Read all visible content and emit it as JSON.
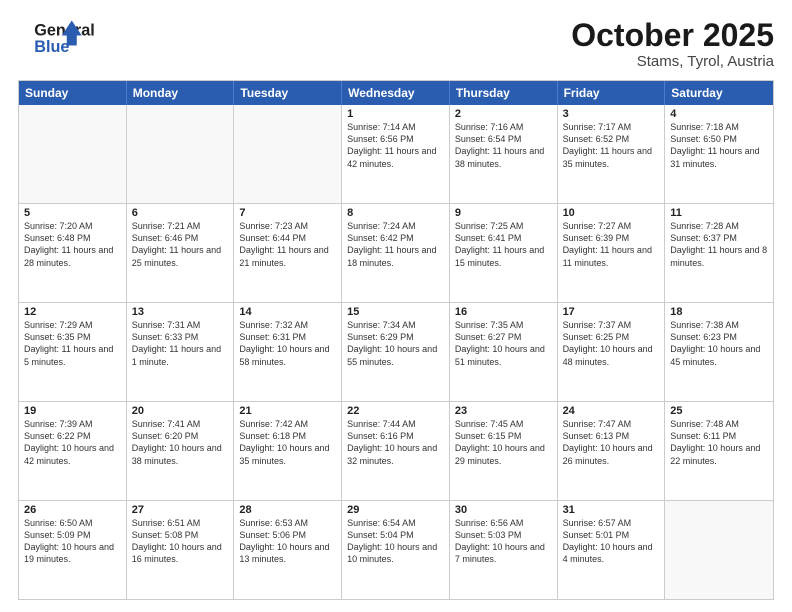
{
  "header": {
    "logo_general": "General",
    "logo_blue": "Blue",
    "month": "October 2025",
    "location": "Stams, Tyrol, Austria"
  },
  "weekdays": [
    "Sunday",
    "Monday",
    "Tuesday",
    "Wednesday",
    "Thursday",
    "Friday",
    "Saturday"
  ],
  "weeks": [
    [
      {
        "day": "",
        "text": "",
        "empty": true
      },
      {
        "day": "",
        "text": "",
        "empty": true
      },
      {
        "day": "",
        "text": "",
        "empty": true
      },
      {
        "day": "1",
        "text": "Sunrise: 7:14 AM\nSunset: 6:56 PM\nDaylight: 11 hours and 42 minutes."
      },
      {
        "day": "2",
        "text": "Sunrise: 7:16 AM\nSunset: 6:54 PM\nDaylight: 11 hours and 38 minutes."
      },
      {
        "day": "3",
        "text": "Sunrise: 7:17 AM\nSunset: 6:52 PM\nDaylight: 11 hours and 35 minutes."
      },
      {
        "day": "4",
        "text": "Sunrise: 7:18 AM\nSunset: 6:50 PM\nDaylight: 11 hours and 31 minutes."
      }
    ],
    [
      {
        "day": "5",
        "text": "Sunrise: 7:20 AM\nSunset: 6:48 PM\nDaylight: 11 hours and 28 minutes."
      },
      {
        "day": "6",
        "text": "Sunrise: 7:21 AM\nSunset: 6:46 PM\nDaylight: 11 hours and 25 minutes."
      },
      {
        "day": "7",
        "text": "Sunrise: 7:23 AM\nSunset: 6:44 PM\nDaylight: 11 hours and 21 minutes."
      },
      {
        "day": "8",
        "text": "Sunrise: 7:24 AM\nSunset: 6:42 PM\nDaylight: 11 hours and 18 minutes."
      },
      {
        "day": "9",
        "text": "Sunrise: 7:25 AM\nSunset: 6:41 PM\nDaylight: 11 hours and 15 minutes."
      },
      {
        "day": "10",
        "text": "Sunrise: 7:27 AM\nSunset: 6:39 PM\nDaylight: 11 hours and 11 minutes."
      },
      {
        "day": "11",
        "text": "Sunrise: 7:28 AM\nSunset: 6:37 PM\nDaylight: 11 hours and 8 minutes."
      }
    ],
    [
      {
        "day": "12",
        "text": "Sunrise: 7:29 AM\nSunset: 6:35 PM\nDaylight: 11 hours and 5 minutes."
      },
      {
        "day": "13",
        "text": "Sunrise: 7:31 AM\nSunset: 6:33 PM\nDaylight: 11 hours and 1 minute."
      },
      {
        "day": "14",
        "text": "Sunrise: 7:32 AM\nSunset: 6:31 PM\nDaylight: 10 hours and 58 minutes."
      },
      {
        "day": "15",
        "text": "Sunrise: 7:34 AM\nSunset: 6:29 PM\nDaylight: 10 hours and 55 minutes."
      },
      {
        "day": "16",
        "text": "Sunrise: 7:35 AM\nSunset: 6:27 PM\nDaylight: 10 hours and 51 minutes."
      },
      {
        "day": "17",
        "text": "Sunrise: 7:37 AM\nSunset: 6:25 PM\nDaylight: 10 hours and 48 minutes."
      },
      {
        "day": "18",
        "text": "Sunrise: 7:38 AM\nSunset: 6:23 PM\nDaylight: 10 hours and 45 minutes."
      }
    ],
    [
      {
        "day": "19",
        "text": "Sunrise: 7:39 AM\nSunset: 6:22 PM\nDaylight: 10 hours and 42 minutes."
      },
      {
        "day": "20",
        "text": "Sunrise: 7:41 AM\nSunset: 6:20 PM\nDaylight: 10 hours and 38 minutes."
      },
      {
        "day": "21",
        "text": "Sunrise: 7:42 AM\nSunset: 6:18 PM\nDaylight: 10 hours and 35 minutes."
      },
      {
        "day": "22",
        "text": "Sunrise: 7:44 AM\nSunset: 6:16 PM\nDaylight: 10 hours and 32 minutes."
      },
      {
        "day": "23",
        "text": "Sunrise: 7:45 AM\nSunset: 6:15 PM\nDaylight: 10 hours and 29 minutes."
      },
      {
        "day": "24",
        "text": "Sunrise: 7:47 AM\nSunset: 6:13 PM\nDaylight: 10 hours and 26 minutes."
      },
      {
        "day": "25",
        "text": "Sunrise: 7:48 AM\nSunset: 6:11 PM\nDaylight: 10 hours and 22 minutes."
      }
    ],
    [
      {
        "day": "26",
        "text": "Sunrise: 6:50 AM\nSunset: 5:09 PM\nDaylight: 10 hours and 19 minutes."
      },
      {
        "day": "27",
        "text": "Sunrise: 6:51 AM\nSunset: 5:08 PM\nDaylight: 10 hours and 16 minutes."
      },
      {
        "day": "28",
        "text": "Sunrise: 6:53 AM\nSunset: 5:06 PM\nDaylight: 10 hours and 13 minutes."
      },
      {
        "day": "29",
        "text": "Sunrise: 6:54 AM\nSunset: 5:04 PM\nDaylight: 10 hours and 10 minutes."
      },
      {
        "day": "30",
        "text": "Sunrise: 6:56 AM\nSunset: 5:03 PM\nDaylight: 10 hours and 7 minutes."
      },
      {
        "day": "31",
        "text": "Sunrise: 6:57 AM\nSunset: 5:01 PM\nDaylight: 10 hours and 4 minutes."
      },
      {
        "day": "",
        "text": "",
        "empty": true
      }
    ]
  ]
}
